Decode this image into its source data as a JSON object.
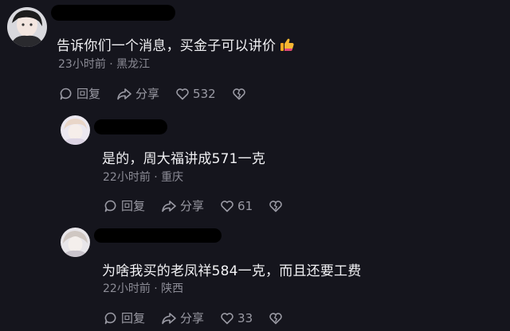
{
  "comments": [
    {
      "text": "告诉你们一个消息，买金子可以讲价",
      "emoji": "thumbs-up-icon",
      "meta": "23小时前 · 黑龙江",
      "reply_label": "回复",
      "share_label": "分享",
      "likes": "532"
    },
    {
      "text": "是的，周大福讲成571一克",
      "meta": "22小时前 · 重庆",
      "reply_label": "回复",
      "share_label": "分享",
      "likes": "61"
    },
    {
      "text": "为啥我买的老凤祥584一克，而且还要工费",
      "meta": "22小时前 · 陕西",
      "reply_label": "回复",
      "share_label": "分享",
      "likes": "33"
    }
  ],
  "colors": {
    "background": "#15151d",
    "text": "#f1f1f4",
    "meta": "#8c8c96",
    "redaction": "#000000"
  }
}
